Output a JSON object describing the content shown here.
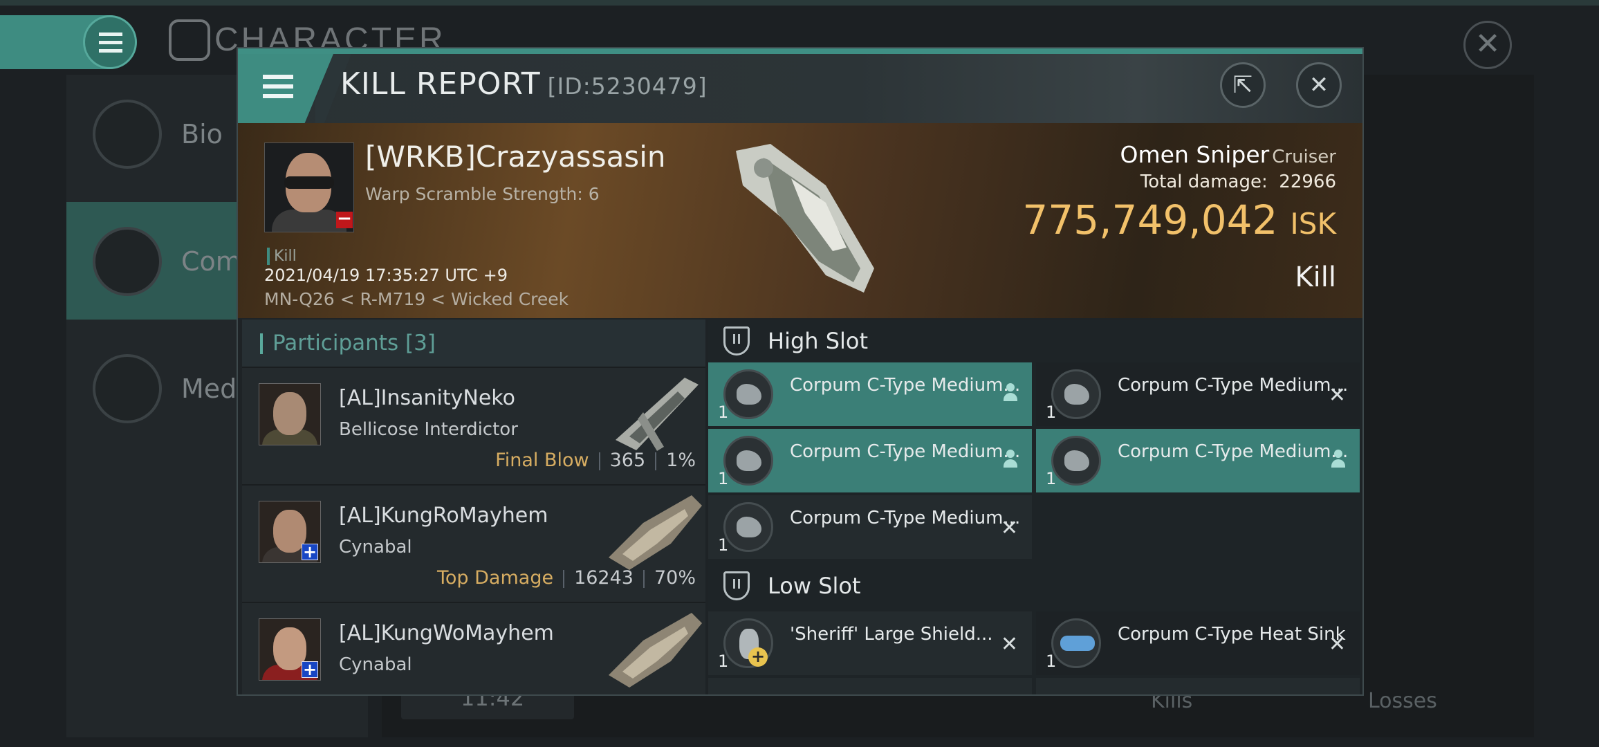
{
  "background": {
    "title": "CHARACTER",
    "nav": [
      {
        "label": "Bio"
      },
      {
        "label": "Com"
      },
      {
        "label": "Meda"
      }
    ],
    "stat_value": "11:42",
    "kills_label": "Kills",
    "losses_label": "Losses"
  },
  "modal": {
    "title": "KILL REPORT",
    "id_text": "[ID:5230479]",
    "victim": {
      "name": "[WRKB]Crazyassasin",
      "subtitle": "Warp Scramble Strength: 6",
      "tag": "Kill",
      "datetime": "2021/04/19 17:35:27 UTC +9",
      "location": "MN-Q26 < R-M719 < Wicked Creek"
    },
    "ship": {
      "name": "Omen Sniper",
      "class": "Cruiser",
      "total_damage_label": "Total damage:",
      "total_damage": "22966",
      "value": "775,749,042",
      "currency": "ISK",
      "type": "Kill"
    },
    "participants": {
      "title": "Participants",
      "count": "[3]",
      "rows": [
        {
          "name": "[AL]InsanityNeko",
          "ship": "Bellicose Interdictor",
          "label": "Final Blow",
          "damage": "365",
          "percent": "1%"
        },
        {
          "name": "[AL]KungRoMayhem",
          "ship": "Cynabal",
          "label": "Top Damage",
          "damage": "16243",
          "percent": "70%"
        },
        {
          "name": "[AL]KungWoMayhem",
          "ship": "Cynabal",
          "label": "",
          "damage": "",
          "percent": ""
        }
      ]
    },
    "fitting": {
      "high_slot_title": "High Slot",
      "low_slot_title": "Low Slot",
      "high": [
        {
          "name": "Corpum C-Type Medium...",
          "qty": "1",
          "status": "dropped"
        },
        {
          "name": "Corpum C-Type Medium...",
          "qty": "1",
          "status": "destroyed"
        },
        {
          "name": "Corpum C-Type Medium...",
          "qty": "1",
          "status": "dropped"
        },
        {
          "name": "Corpum C-Type Medium...",
          "qty": "1",
          "status": "dropped"
        },
        {
          "name": "Corpum C-Type Medium...",
          "qty": "1",
          "status": "destroyed"
        }
      ],
      "low": [
        {
          "name": "'Sheriff' Large Shield...",
          "qty": "1",
          "status": "destroyed"
        },
        {
          "name": "Corpum C-Type Heat Sink",
          "qty": "1",
          "status": "destroyed"
        }
      ]
    }
  },
  "colors": {
    "accent": "#3e8c81",
    "isk": "#f2c16a",
    "highlight_row": "#3b7f77",
    "stat_label": "#d7ad62"
  },
  "icons": {
    "menu": "hamburger-icon",
    "share": "share-icon",
    "close": "close-icon",
    "slot": "slot-shield-icon",
    "dropped": "person-icon",
    "destroyed": "x-icon"
  }
}
